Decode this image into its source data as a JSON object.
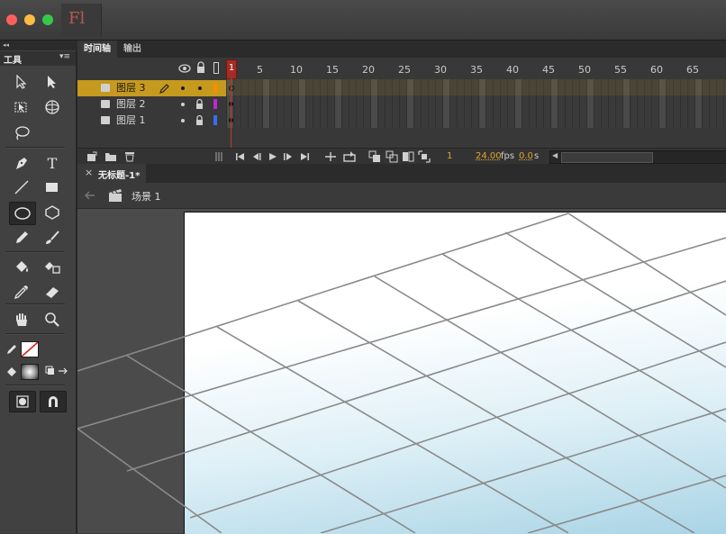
{
  "app": {
    "icon_text": "Fl",
    "window_controls": {
      "close_color": "#fc605b",
      "minimize_color": "#fdbc40",
      "maximize_color": "#34c84a"
    }
  },
  "tools_panel": {
    "collapse_glyph": "◂◂",
    "title": "工具",
    "menu_glyph": "▾≡",
    "tools": [
      "selection-arrow",
      "subselection-arrow",
      "free-transform",
      "3d-rotation",
      "lasso",
      "pen",
      "text",
      "line",
      "rectangle",
      "oval",
      "polystar",
      "pencil",
      "brush",
      "paint-bucket",
      "ink-bottle",
      "eyedropper",
      "eraser",
      "hand",
      "zoom",
      "stroke-color",
      "fill-color",
      "swap-colors",
      "object-drawing",
      "snap-to-objects"
    ],
    "selected_tool": "oval",
    "text_tool_label": "T"
  },
  "timeline": {
    "tabs": [
      "时间轴",
      "输出"
    ],
    "active_tab": "时间轴",
    "frame_ruler": [
      "1",
      "5",
      "10",
      "15",
      "20",
      "25",
      "30",
      "35",
      "40",
      "45",
      "50",
      "55",
      "60",
      "65"
    ],
    "playhead_frame": 1,
    "layers": [
      {
        "name": "图层 3",
        "selected": true,
        "color": "#ff8c00"
      },
      {
        "name": "图层 2",
        "selected": false,
        "color": "#c026d3"
      },
      {
        "name": "图层 1",
        "selected": false,
        "color": "#3b6cf0"
      }
    ],
    "current_frame": "1",
    "fps": "24.00",
    "fps_unit": "fps",
    "elapsed": "0.0",
    "elapsed_unit": "s"
  },
  "document": {
    "tab_close": "×",
    "tab_title": "无标题-1*",
    "scene_label": "场景 1"
  },
  "colors": {
    "accent_orange": "#c69a1e",
    "playhead_red": "#c0392b",
    "stage_bottom": "#a9d4e5"
  }
}
